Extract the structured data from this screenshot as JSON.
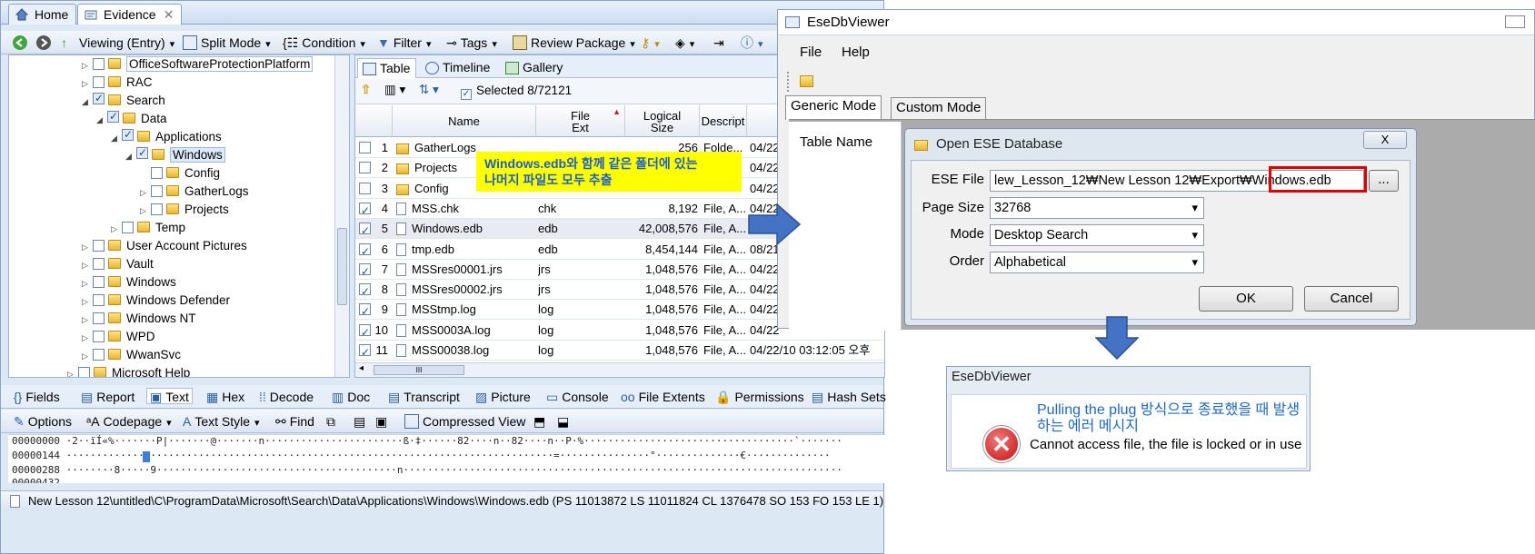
{
  "encase": {
    "tabs": [
      "Home",
      "Evidence"
    ],
    "toolbar1": [
      "Viewing (Entry)",
      "Split Mode",
      "Condition",
      "Filter",
      "Tags",
      "Review Package"
    ],
    "tree": [
      {
        "label": "OfficeSoftwareProtectionPlatform"
      },
      {
        "label": "RAC"
      },
      {
        "label": "Search"
      },
      {
        "label": "Data"
      },
      {
        "label": "Applications"
      },
      {
        "label": "Windows"
      },
      {
        "label": "Config"
      },
      {
        "label": "GatherLogs"
      },
      {
        "label": "Projects"
      },
      {
        "label": "Temp"
      },
      {
        "label": "User Account Pictures"
      },
      {
        "label": "Vault"
      },
      {
        "label": "Windows"
      },
      {
        "label": "Windows Defender"
      },
      {
        "label": "Windows NT"
      },
      {
        "label": "WPD"
      },
      {
        "label": "WwanSvc"
      },
      {
        "label": "Microsoft Help"
      }
    ],
    "view_tabs": [
      "Table",
      "Timeline",
      "Gallery"
    ],
    "selected_count": "Selected 8/72121",
    "columns": {
      "name": "Name",
      "ext_1": "File",
      "ext_2": "Ext",
      "size_1": "Logical",
      "size_2": "Size",
      "desc": "Descript"
    },
    "rows": [
      {
        "num": "1",
        "name": "GatherLogs",
        "ext": "",
        "size": "256",
        "desc": "Folde...",
        "date": "04/22",
        "checked": false,
        "folder": true
      },
      {
        "num": "2",
        "name": "Projects",
        "ext": "",
        "size": "",
        "desc": "",
        "date": "04/22",
        "checked": false,
        "folder": true
      },
      {
        "num": "3",
        "name": "Config",
        "ext": "",
        "size": "",
        "desc": "",
        "date": "04/22",
        "checked": false,
        "folder": true
      },
      {
        "num": "4",
        "name": "MSS.chk",
        "ext": "chk",
        "size": "8,192",
        "desc": "File, A...",
        "date": "04/22",
        "checked": true,
        "folder": false
      },
      {
        "num": "5",
        "name": "Windows.edb",
        "ext": "edb",
        "size": "42,008,576",
        "desc": "File, A...",
        "date": "",
        "checked": true,
        "folder": false
      },
      {
        "num": "6",
        "name": "tmp.edb",
        "ext": "edb",
        "size": "8,454,144",
        "desc": "File, A...",
        "date": "08/21",
        "checked": true,
        "folder": false
      },
      {
        "num": "7",
        "name": "MSSres00001.jrs",
        "ext": "jrs",
        "size": "1,048,576",
        "desc": "File, A...",
        "date": "04/22",
        "checked": true,
        "folder": false
      },
      {
        "num": "8",
        "name": "MSSres00002.jrs",
        "ext": "jrs",
        "size": "1,048,576",
        "desc": "File, A...",
        "date": "04/22",
        "checked": true,
        "folder": false
      },
      {
        "num": "9",
        "name": "MSStmp.log",
        "ext": "log",
        "size": "1,048,576",
        "desc": "File, A...",
        "date": "04/22",
        "checked": true,
        "folder": false
      },
      {
        "num": "10",
        "name": "MSS0003A.log",
        "ext": "log",
        "size": "1,048,576",
        "desc": "File, A...",
        "date": "04/22",
        "checked": true,
        "folder": false
      },
      {
        "num": "11",
        "name": "MSS00038.log",
        "ext": "log",
        "size": "1,048,576",
        "desc": "File, A...",
        "date": "04/22/10 03:12:05 오후",
        "checked": true,
        "folder": false
      }
    ],
    "annotation": "Windows.edb와 함께 같은 폴더에 있는 나머지 파일도 모두 추출",
    "annotation_l1": "Windows.edb와 함께 같은 폴더에 있는",
    "annotation_l2": "나머지 파일도 모두 추출",
    "bottom_tabs": [
      "Fields",
      "Report",
      "Text",
      "Hex",
      "Decode",
      "Doc",
      "Transcript",
      "Picture",
      "Console",
      "File Extents",
      "Permissions",
      "Hash Sets"
    ],
    "bottom_tools": [
      "Options",
      "Codepage",
      "Text Style",
      "Find",
      "Compressed View"
    ],
    "hex_lines": [
      "00000000 ·2··ïÍ«%·······P|·······@·······n·······················ß·‡······82····n··82····n··P·%···································`·······",
      "00000144 ·················································································=···············°··············€··············",
      "00000288 ········8·····9········································n·········································································",
      "00000432"
    ],
    "status": "New Lesson 12\\untitled\\C\\ProgramData\\Microsoft\\Search\\Data\\Applications\\Windows\\Windows.edb (PS 11013872 LS 11011824 CL 1376478 SO 153 FO 153 LE 1)"
  },
  "ese": {
    "title": "EseDbViewer",
    "menu": [
      "File",
      "Help"
    ],
    "tabs": [
      "Generic Mode",
      "Custom Mode"
    ],
    "table_name_label": "Table Name",
    "open_dialog": {
      "title": "Open ESE Database",
      "close": "X",
      "labels": {
        "file": "ESE File",
        "page": "Page Size",
        "mode": "Mode",
        "order": "Order"
      },
      "ese_file_value": "lew_Lesson_12₩New Lesson 12₩Export₩Windows.edb",
      "page_size": "32768",
      "mode": "Desktop Search",
      "order": "Alphabetical",
      "browse": "...",
      "ok": "OK",
      "cancel": "Cancel"
    }
  },
  "error": {
    "title": "EseDbViewer",
    "note": "Pulling the plug 방식으로 종료했을 때 발생하는 에러 메시지",
    "message": "Cannot access file, the file is locked or in use"
  }
}
